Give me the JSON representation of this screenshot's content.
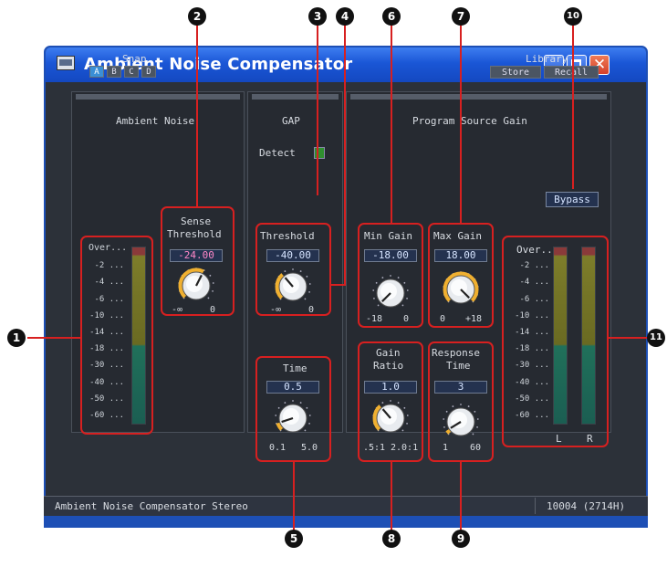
{
  "window": {
    "title": "Ambient Noise Compensator"
  },
  "snap": {
    "label": "Snap",
    "buttons": [
      "A",
      "B",
      "C",
      "D"
    ],
    "active": "A"
  },
  "library": {
    "label": "Library",
    "store": "Store",
    "recall": "Recall"
  },
  "panels": {
    "ambient": {
      "title": "Ambient Noise"
    },
    "gap": {
      "title": "GAP",
      "detect_label": "Detect"
    },
    "program": {
      "title": "Program Source Gain",
      "bypass": "Bypass"
    }
  },
  "controls": {
    "sense_threshold": {
      "label_line1": "Sense",
      "label_line2": "Threshold",
      "value": "-24.00",
      "min": "-∞",
      "max": "0",
      "level": 0.6
    },
    "threshold": {
      "label": "Threshold",
      "value": "-40.00",
      "min": "-∞",
      "max": "0",
      "level": 0.35
    },
    "time": {
      "label": "Time",
      "value": "0.5",
      "min": "0.1",
      "max": "5.0",
      "level": 0.1
    },
    "min_gain": {
      "label": "Min Gain",
      "value": "-18.00",
      "min": "-18",
      "max": "0",
      "level": 0.0
    },
    "max_gain": {
      "label": "Max Gain",
      "value": "18.00",
      "min": "0",
      "max": "+18",
      "level": 1.0
    },
    "gain_ratio": {
      "label_line1": "Gain",
      "label_line2": "Ratio",
      "value": "1.0",
      "min": ".5:1",
      "max": "2.0:1",
      "level": 0.35
    },
    "response_time": {
      "label_line1": "Response",
      "label_line2": "Time",
      "value": "3",
      "min": "1",
      "max": "60",
      "level": 0.05
    }
  },
  "meters": {
    "labels": [
      "Over",
      "-2",
      "-4",
      "-6",
      "-10",
      "-14",
      "-18",
      "-30",
      "-40",
      "-50",
      "-60"
    ],
    "ambient_label": "Over...",
    "channels": [
      "L",
      "R"
    ]
  },
  "status": {
    "left": "Ambient Noise Compensator   Stereo",
    "right": "10004 (2714H)"
  },
  "callouts": [
    "1",
    "2",
    "3",
    "4",
    "5",
    "6",
    "7",
    "8",
    "9",
    "10",
    "11"
  ],
  "colors": {
    "title_bar": "#1a56d6",
    "highlight": "#d72020",
    "knob_arc": "#f0b030",
    "value_text": "#d6e4ff",
    "value_text_accent": "#ff88c8",
    "detect_led": "#2f8f2f"
  }
}
